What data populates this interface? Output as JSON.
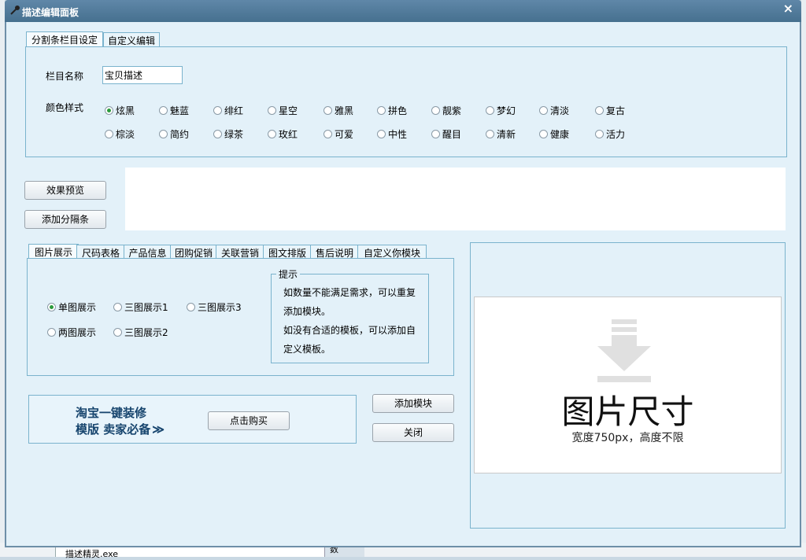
{
  "window": {
    "title": "描述编辑面板",
    "close": "×"
  },
  "top_tabs": [
    "分割条栏目设定",
    "自定义编辑"
  ],
  "column_name": {
    "label": "栏目名称",
    "value": "宝贝描述"
  },
  "color_style": {
    "label": "颜色样式",
    "selected": "炫黑",
    "options_row1": [
      "炫黑",
      "魅蓝",
      "绯红",
      "星空",
      "雅黑",
      "拼色",
      "靓紫",
      "梦幻",
      "清淡",
      "复古"
    ],
    "options_row2": [
      "棕淡",
      "简约",
      "绿茶",
      "玫红",
      "可爱",
      "中性",
      "醒目",
      "清新",
      "健康",
      "活力"
    ]
  },
  "buttons": {
    "preview": "效果预览",
    "add_divider": "添加分隔条",
    "add_module": "添加模块",
    "close": "关闭",
    "buy": "点击购买"
  },
  "module_tabs": [
    "图片展示",
    "尺码表格",
    "产品信息",
    "团购促销",
    "关联营销",
    "图文排版",
    "售后说明",
    "自定义你模块"
  ],
  "display_options": {
    "selected": "单图展示",
    "row1": [
      "单图展示",
      "三图展示1",
      "三图展示3"
    ],
    "row2": [
      "两图展示",
      "三图展示2"
    ]
  },
  "hint": {
    "title": "提示",
    "lines": [
      "如数量不能满足需求，可以重复",
      "添加模块。",
      "如没有合适的模板，可以添加自",
      "定义模板。"
    ]
  },
  "ad": {
    "line1": "淘宝一键装修",
    "line2": "模版 卖家必备",
    "arrow": "≫"
  },
  "preview_image": {
    "title": "图片尺寸",
    "subtitle": "宽度750px，高度不限"
  },
  "background": {
    "taskbar_item": "描述精灵.exe",
    "side_text": "数"
  },
  "colors": {
    "titlebar": "#4f7a9b",
    "panel": "#e3f1f9",
    "border": "#7ab3cd",
    "ad_text": "#17456e",
    "radio_on": "#2a9a3c"
  }
}
